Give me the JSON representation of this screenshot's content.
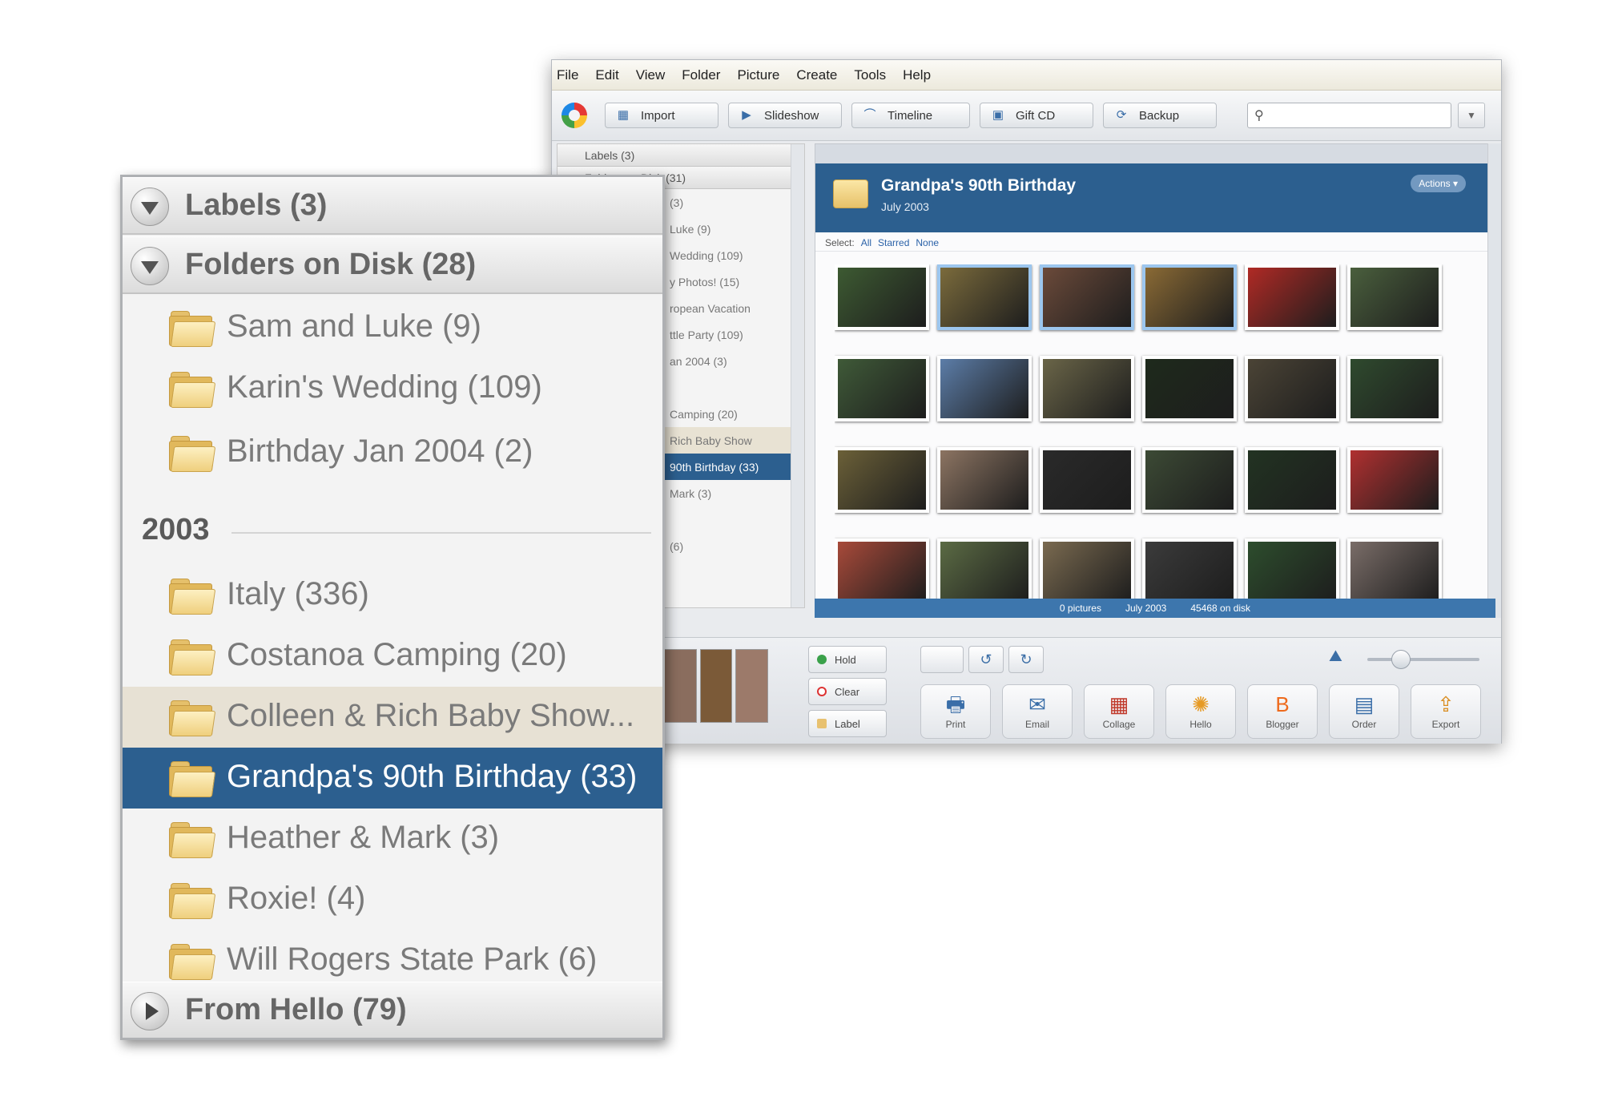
{
  "app": {
    "menu": [
      "File",
      "Edit",
      "View",
      "Folder",
      "Picture",
      "Create",
      "Tools",
      "Help"
    ],
    "toolbar": {
      "import": "Import",
      "slideshow": "Slideshow",
      "timeline": "Timeline",
      "gift_cd": "Gift CD",
      "backup": "Backup"
    },
    "search": {
      "placeholder": ""
    },
    "left_mini": {
      "labels_header": "Labels (3)",
      "folders_header": "Folders on Disk (31)",
      "rows": [
        "(3)",
        "Luke (9)",
        "Wedding (109)",
        "y Photos! (15)",
        "ropean Vacation",
        "ttle Party (109)",
        "an 2004 (3)",
        "",
        "Camping (20)",
        "Rich Baby Show",
        "90th Birthday (33)",
        "Mark (3)",
        "",
        "(6)"
      ]
    },
    "album": {
      "title": "Grandpa's 90th Birthday",
      "subtitle": "July 2003",
      "actions": "Actions",
      "select_label": "Select:",
      "select_all": "All",
      "select_starred": "Starred",
      "select_none": "None",
      "status": [
        "0 pictures",
        "July 2003",
        "45468 on disk"
      ]
    },
    "bottom": {
      "hold": "Hold",
      "clear": "Clear",
      "label": "Label",
      "actions": [
        {
          "label": "Print",
          "icon": "printer-icon"
        },
        {
          "label": "Email",
          "icon": "email-icon"
        },
        {
          "label": "Collage",
          "icon": "collage-icon"
        },
        {
          "label": "Hello",
          "icon": "hello-icon"
        },
        {
          "label": "Blogger",
          "icon": "blogger-icon"
        },
        {
          "label": "Order",
          "icon": "order-icon"
        },
        {
          "label": "Export",
          "icon": "export-icon"
        }
      ]
    },
    "thumb_colors": [
      [
        "#3d5a32",
        "#7b6b3c",
        "#6b4a3a",
        "#8a6a35",
        "#b02a25",
        "#4a5f3d"
      ],
      [
        "#3f5a38",
        "#5c7da8",
        "#6a6548",
        "#1e2a1c",
        "#4b4436",
        "#2f4a2e"
      ],
      [
        "#6b6038",
        "#8c7462",
        "#2a2a2a",
        "#3c4a35",
        "#223322",
        "#b03030"
      ],
      [
        "#a84a3a",
        "#5b6b44",
        "#7a6a50",
        "#3b3b3b",
        "#2d4d2d",
        "#7a6d68"
      ]
    ]
  },
  "panel": {
    "labels_header": "Labels (3)",
    "folders_header": "Folders on Disk (28)",
    "folders_top": [
      "Sam and Luke (9)",
      "Karin's Wedding (109)",
      "Birthday Jan 2004 (2)"
    ],
    "year": "2003",
    "folders_2003": [
      "Italy (336)",
      "Costanoa Camping (20)",
      "Colleen & Rich Baby Show...",
      "Grandpa's 90th Birthday (33)",
      "Heather & Mark (3)",
      "Roxie! (4)",
      "Will Rogers State Park (6)"
    ],
    "selected_folder": "Grandpa's 90th Birthday (33)",
    "highlighted_folder": "Colleen & Rich Baby Show...",
    "hello_header": "From Hello (79)"
  }
}
